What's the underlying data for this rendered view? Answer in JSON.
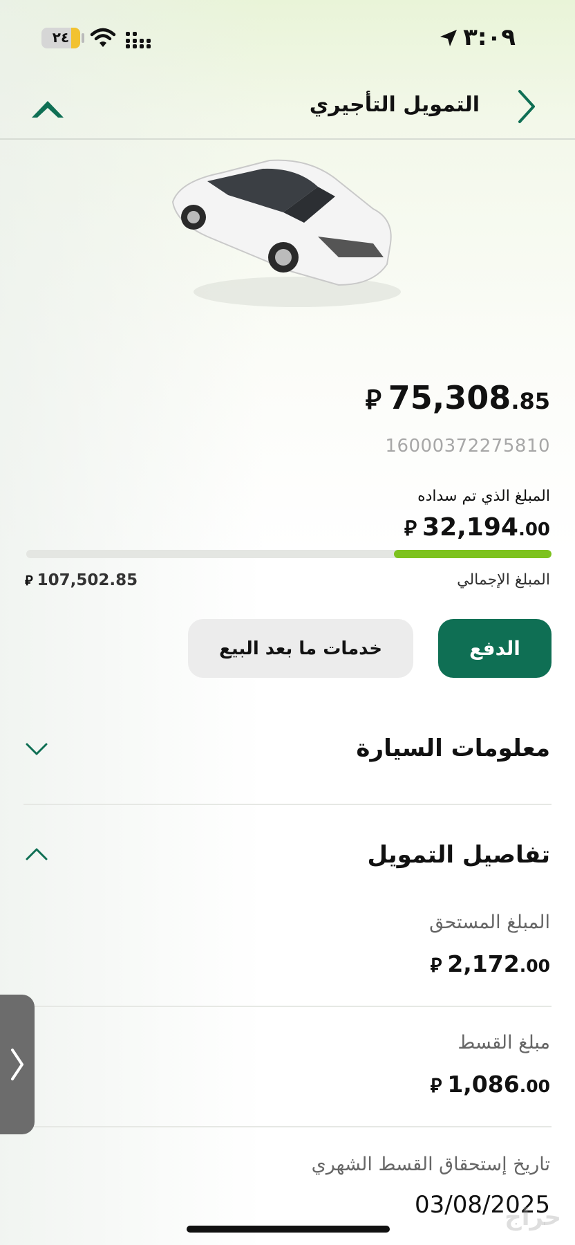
{
  "status_bar": {
    "time": "٣:٠٩",
    "battery_level": "٢٤",
    "battery_fill_fraction": 0.24
  },
  "header": {
    "title": "التمويل التأجيري"
  },
  "financing": {
    "remaining_int": "75,308",
    "remaining_dec": ".85",
    "contract_number": "16000372275810",
    "paid_label": "المبلغ الذي تم سداده",
    "paid_int": "32,194",
    "paid_dec": ".00",
    "total_label": "المبلغ الإجمالي",
    "total_amount": "107,502.85",
    "progress_fraction": 0.2995,
    "currency_symbol": "⃁"
  },
  "buttons": {
    "pay": "الدفع",
    "after_sales": "خدمات ما بعد البيع"
  },
  "sections": {
    "car_info": "معلومات السيارة",
    "financing_details": "تفاصيل التمويل"
  },
  "details": {
    "due_label": "المبلغ المستحق",
    "due_int": "2,172",
    "due_dec": ".00",
    "installment_label": "مبلغ القسط",
    "installment_int": "1,086",
    "installment_dec": ".00",
    "monthly_date_label": "تاريخ إستحقاق القسط الشهري",
    "monthly_date": "03/08/2025"
  },
  "watermark": "حراج",
  "colors": {
    "brand_green": "#0f6f54",
    "progress_green": "#7dc21e"
  }
}
